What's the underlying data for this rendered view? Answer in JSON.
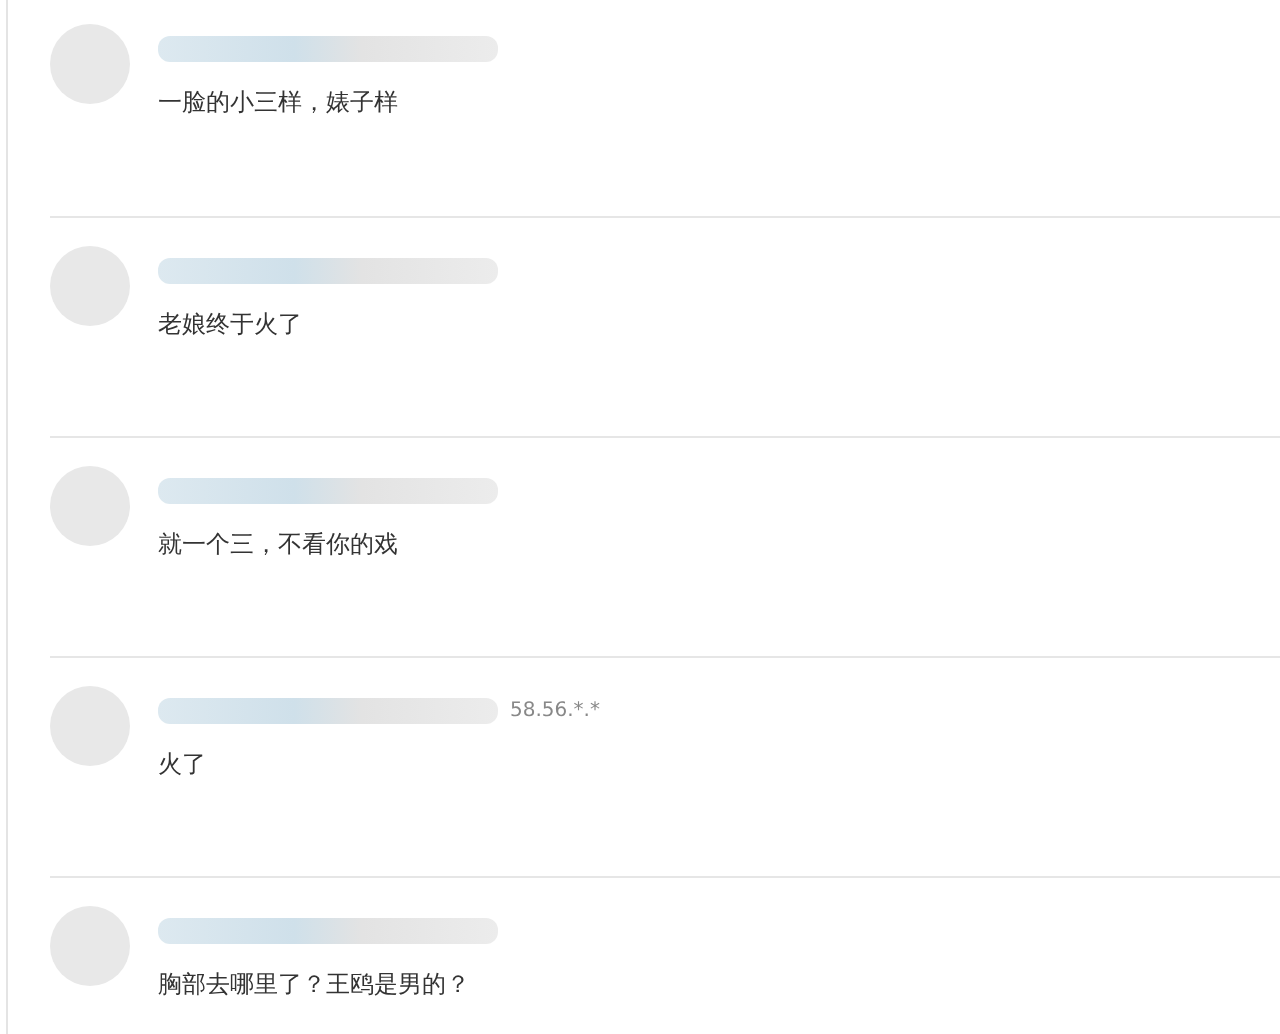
{
  "comments": [
    {
      "text": "一脸的小三样，婊子样"
    },
    {
      "text": "老娘终于火了"
    },
    {
      "text": "就一个三，不看你的戏"
    },
    {
      "ip": "58.56.*.*",
      "text": "火了"
    },
    {
      "text": "胸部去哪里了？王鸥是男的？"
    }
  ]
}
